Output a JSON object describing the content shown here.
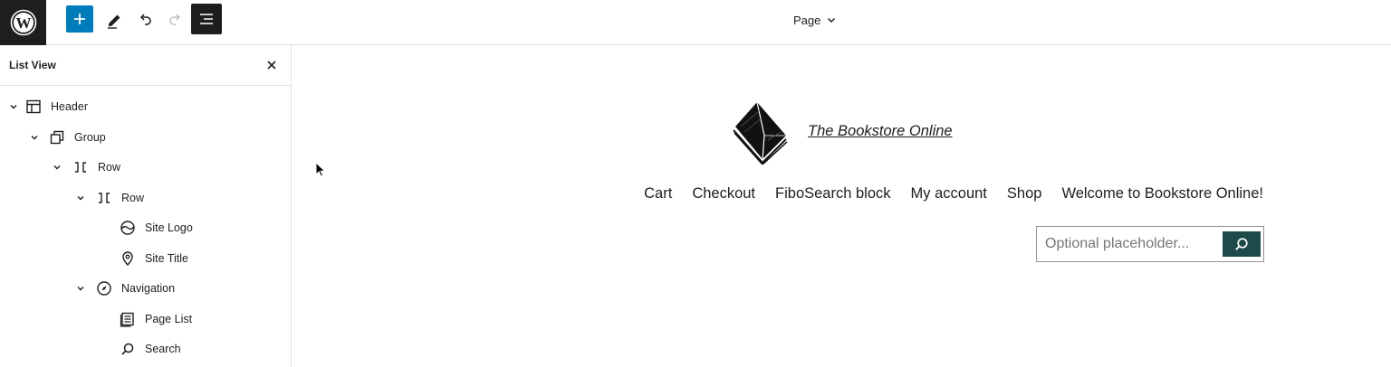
{
  "toolbar": {
    "document_title": "Page",
    "icons": [
      "wordpress-icon",
      "plus-icon",
      "pencil-icon",
      "undo-icon",
      "redo-icon",
      "list-view-icon",
      "chevron-down-icon"
    ]
  },
  "sidebar": {
    "title": "List View",
    "items": [
      {
        "label": "Header",
        "icon": "template-part-icon",
        "expandable": true
      },
      {
        "label": "Group",
        "icon": "group-icon",
        "expandable": true
      },
      {
        "label": "Row",
        "icon": "row-icon",
        "expandable": true
      },
      {
        "label": "Row",
        "icon": "row-icon",
        "expandable": true
      },
      {
        "label": "Site Logo",
        "icon": "site-logo-icon",
        "expandable": false
      },
      {
        "label": "Site Title",
        "icon": "map-pin-icon",
        "expandable": false
      },
      {
        "label": "Navigation",
        "icon": "compass-icon",
        "expandable": true
      },
      {
        "label": "Page List",
        "icon": "page-list-icon",
        "expandable": false
      },
      {
        "label": "Search",
        "icon": "search-icon",
        "expandable": false
      }
    ]
  },
  "canvas": {
    "site_title": "The Bookstore Online",
    "logo": "open-book-logo",
    "nav_items": [
      "Cart",
      "Checkout",
      "FiboSearch block",
      "My account",
      "Shop",
      "Welcome to Bookstore Online!"
    ],
    "search": {
      "placeholder": "Optional placeholder...",
      "value": "",
      "button_color": "#1f4a4a"
    }
  },
  "colors": {
    "accent": "#007cba",
    "dark": "#1e1e1e"
  }
}
